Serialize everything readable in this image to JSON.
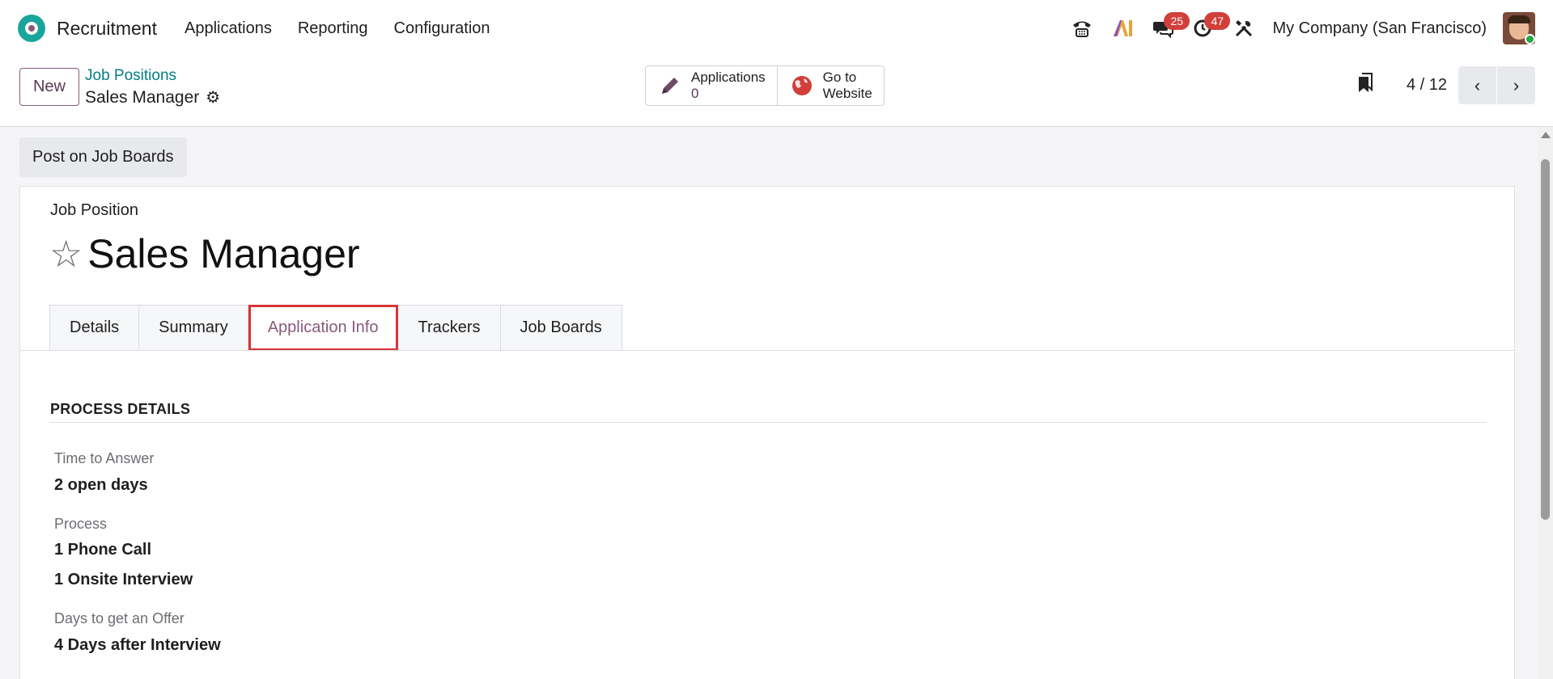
{
  "navbar": {
    "app_name": "Recruitment",
    "menu": [
      "Applications",
      "Reporting",
      "Configuration"
    ],
    "icons": [
      "phone-icon",
      "ai-icon",
      "messages-icon",
      "activity-clock-icon",
      "tools-icon"
    ],
    "messages_count": "25",
    "activities_count": "47",
    "company": "My Company (San Francisco)"
  },
  "control": {
    "new_label": "New",
    "breadcrumb_parent": "Job Positions",
    "breadcrumb_current": "Sales Manager",
    "smart_applications_label": "Applications",
    "smart_applications_count": "0",
    "smart_website_line1": "Go to",
    "smart_website_line2": "Website",
    "pager_value": "4 / 12"
  },
  "form": {
    "status_button": "Post on Job Boards",
    "record_label": "Job Position",
    "title": "Sales Manager",
    "tabs": [
      "Details",
      "Summary",
      "Application Info",
      "Trackers",
      "Job Boards"
    ],
    "active_tab": "Application Info",
    "section_title": "PROCESS DETAILS",
    "time_to_answer_label": "Time to Answer",
    "time_to_answer_value": "2 open days",
    "process_label": "Process",
    "process_values": [
      "1 Phone Call",
      "1 Onsite Interview"
    ],
    "offer_label": "Days to get an Offer",
    "offer_value": "4 Days after Interview"
  },
  "colors": {
    "brand": "#875a7b",
    "link": "#017e84",
    "badge": "#d23f3a",
    "highlight": "#d93535"
  }
}
